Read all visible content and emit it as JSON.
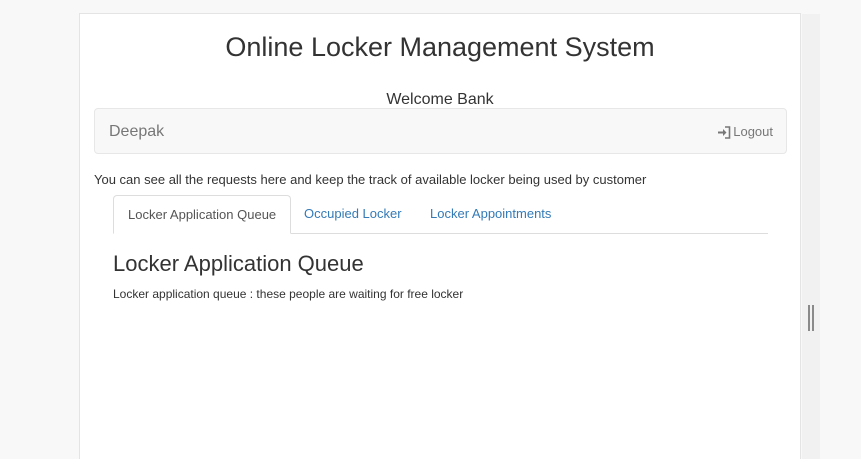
{
  "header": {
    "title": "Online Locker Management System",
    "welcome": "Welcome Bank"
  },
  "navbar": {
    "brand": "Deepak",
    "logout_label": "Logout",
    "logout_icon": "sign-in-icon"
  },
  "intro_text": "You can see all the requests here and keep the track of available locker being used by customer",
  "tabs": [
    {
      "label": "Locker Application Queue",
      "active": true
    },
    {
      "label": "Occupied Locker",
      "active": false
    },
    {
      "label": "Locker Appointments",
      "active": false
    }
  ],
  "section": {
    "heading": "Locker Application Queue",
    "description": "Locker application queue : these people are waiting for free locker"
  },
  "colors": {
    "link": "#337ab7",
    "navbar_bg": "#f8f8f8",
    "text": "#333333"
  }
}
